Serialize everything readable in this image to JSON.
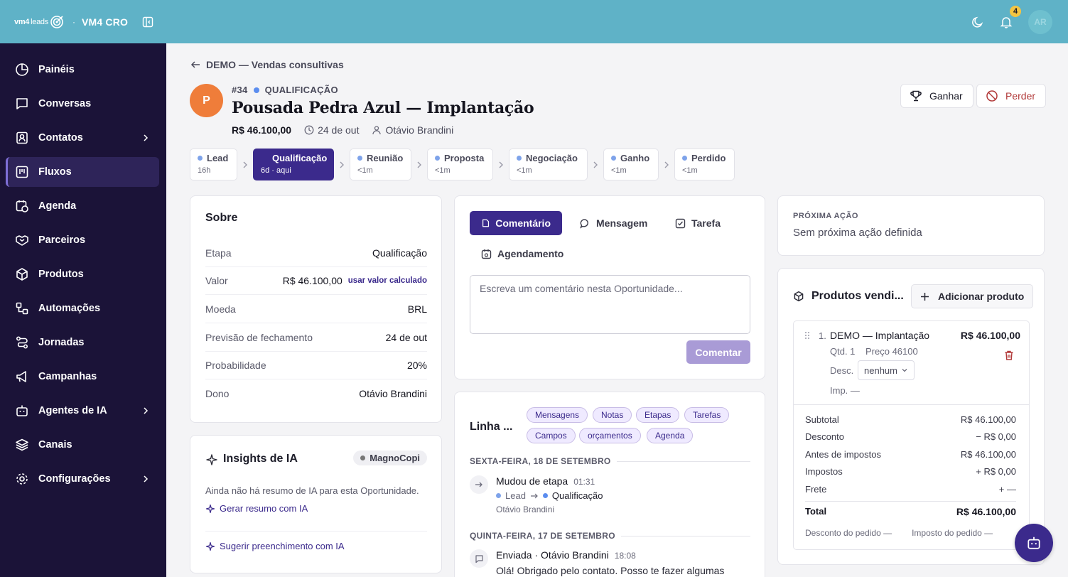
{
  "topbar": {
    "logo_text_a": "vm4",
    "logo_text_b": "leads",
    "org_sep": "·",
    "org_name": "VM4 CRO",
    "notifications_count": "4",
    "user_initials": "AR"
  },
  "sidebar": {
    "items": [
      {
        "label": "Painéis"
      },
      {
        "label": "Conversas"
      },
      {
        "label": "Contatos"
      },
      {
        "label": "Fluxos"
      },
      {
        "label": "Agenda"
      },
      {
        "label": "Parceiros"
      },
      {
        "label": "Produtos"
      },
      {
        "label": "Automações"
      },
      {
        "label": "Jornadas"
      },
      {
        "label": "Campanhas"
      },
      {
        "label": "Agentes de IA"
      },
      {
        "label": "Canais"
      },
      {
        "label": "Configurações"
      }
    ]
  },
  "header": {
    "back_label": "DEMO — Vendas consultivas",
    "avatar_letter": "P",
    "deal_number": "#34",
    "stage_label": "QUALIFICAÇÃO",
    "title": "Pousada Pedra Azul — Implantação",
    "value": "R$ 46.100,00",
    "date": "24 de out",
    "owner": "Otávio Brandini",
    "win_label": "Ganhar",
    "lose_label": "Perder"
  },
  "stages": [
    {
      "name": "Lead",
      "time": "16h"
    },
    {
      "name": "Qualificação",
      "time": "6d · aqui"
    },
    {
      "name": "Reunião",
      "time": "<1m"
    },
    {
      "name": "Proposta",
      "time": "<1m"
    },
    {
      "name": "Negociação",
      "time": "<1m"
    },
    {
      "name": "Ganho",
      "time": "<1m"
    },
    {
      "name": "Perdido",
      "time": "<1m"
    }
  ],
  "about": {
    "title": "Sobre",
    "rows": [
      {
        "key": "Etapa",
        "value": "Qualificação"
      },
      {
        "key": "Valor",
        "value": "R$ 46.100,00",
        "link": "usar valor calculado"
      },
      {
        "key": "Moeda",
        "value": "BRL"
      },
      {
        "key": "Previsão de fechamento",
        "value": "24 de out"
      },
      {
        "key": "Probabilidade",
        "value": "20%"
      },
      {
        "key": "Dono",
        "value": "Otávio Brandini"
      }
    ]
  },
  "ai": {
    "title": "Insights de IA",
    "pill": "MagnoCopi",
    "empty_text": "Ainda não há resumo de IA para esta Oportunidade.",
    "link_summary": "Gerar resumo com IA",
    "link_fill": "Sugerir preenchimento com IA"
  },
  "composer": {
    "tabs": [
      {
        "label": "Comentário"
      },
      {
        "label": "Mensagem"
      },
      {
        "label": "Tarefa"
      },
      {
        "label": "Agendamento"
      }
    ],
    "placeholder": "Escreva um comentário nesta Oportunidade...",
    "submit_label": "Comentar"
  },
  "timeline": {
    "title": "Linha ...",
    "filters": [
      "Mensagens",
      "Notas",
      "Etapas",
      "Tarefas",
      "Campos",
      "orçamentos",
      "Agenda"
    ],
    "day1": "SEXTA-FEIRA, 18 DE SETEMBRO",
    "event1": {
      "title": "Mudou de etapa",
      "time": "01:31",
      "from": "Lead",
      "to": "Qualificação",
      "by": "Otávio Brandini"
    },
    "day2": "QUINTA-FEIRA, 17 DE SETEMBRO",
    "event2": {
      "title": "Enviada · Otávio Brandini",
      "time": "18:08",
      "message": "Olá! Obrigado pelo contato. Posso te fazer algumas"
    }
  },
  "next_action": {
    "label": "PRÓXIMA AÇÃO",
    "value": "Sem próxima ação definida"
  },
  "products": {
    "title": "Produtos vendi...",
    "add_label": "Adicionar produto",
    "item": {
      "index": "1.",
      "name": "DEMO — Implantação",
      "total": "R$ 46.100,00",
      "qty": "Qtd. 1",
      "price": "Preço 46100",
      "desc_label": "Desc.",
      "desc_value": "nenhum",
      "tax": "Imp. —"
    },
    "summary": [
      {
        "key": "Subtotal",
        "value": "R$ 46.100,00"
      },
      {
        "key": "Desconto",
        "value": "− R$ 0,00"
      },
      {
        "key": "Antes de impostos",
        "value": "R$ 46.100,00"
      },
      {
        "key": "Impostos",
        "value": "+ R$ 0,00"
      },
      {
        "key": "Frete",
        "value": "+ —"
      }
    ],
    "total_key": "Total",
    "total_value": "R$ 46.100,00",
    "order_discount": "Desconto do pedido —",
    "order_tax": "Imposto do pedido —"
  },
  "colors": {
    "topbar": "#5fb2c7",
    "sidebar": "#1b1338",
    "accent": "#3b2a8c",
    "avatar": "#ef7d3a"
  }
}
